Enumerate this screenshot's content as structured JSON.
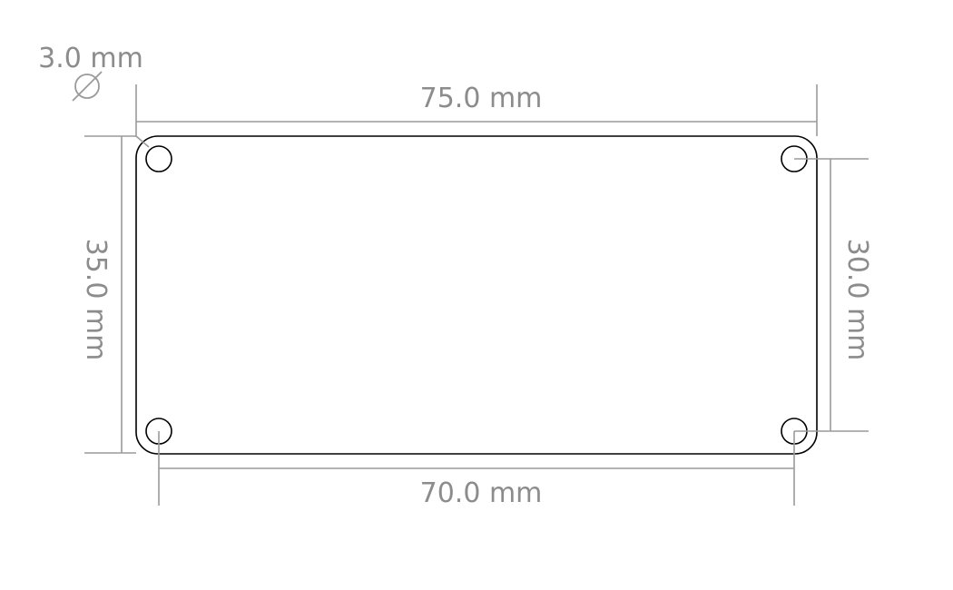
{
  "drawing": {
    "plate": {
      "width_mm": 75.0,
      "height_mm": 35.0,
      "hole_spacing_x_mm": 70.0,
      "hole_spacing_y_mm": 30.0,
      "hole_diameter_mm": 3.0
    },
    "dimensions": {
      "hole_diameter_label": "3.0 mm",
      "width_label": "75.0 mm",
      "height_label": "35.0 mm",
      "hole_spacing_y_label": "30.0 mm",
      "hole_spacing_x_label": "70.0 mm"
    },
    "colors": {
      "outline": "#000000",
      "dimension": "#9a9a9a"
    }
  }
}
